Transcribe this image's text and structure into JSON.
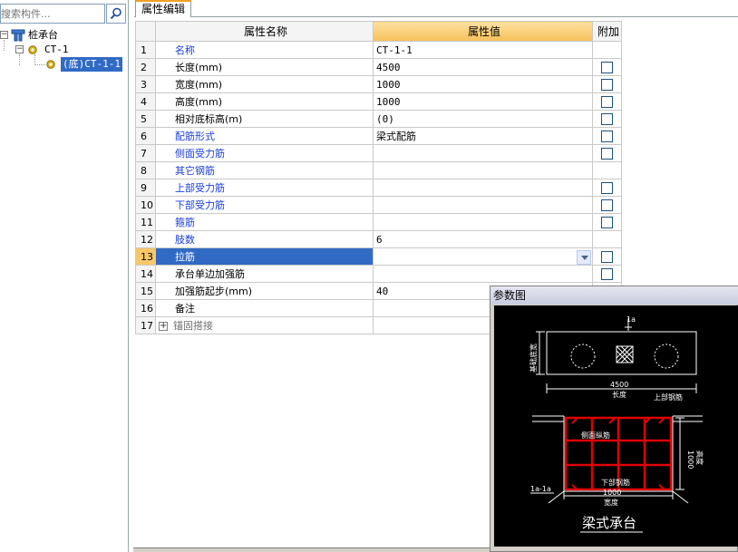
{
  "search": {
    "placeholder": "搜索构件..."
  },
  "tree": {
    "root_label": "桩承台",
    "child_label": "CT-1",
    "grandchild_label": "(底)CT-1-1"
  },
  "tabs": {
    "attr_edit": "属性编辑"
  },
  "grid": {
    "headers": {
      "name": "属性名称",
      "value": "属性值",
      "extra": "附加"
    },
    "rows": [
      {
        "num": "1",
        "name": "名称",
        "value": "CT-1-1",
        "checkbox": false,
        "style": "blue"
      },
      {
        "num": "2",
        "name": "长度(mm)",
        "value": "4500",
        "checkbox": true,
        "style": "black"
      },
      {
        "num": "3",
        "name": "宽度(mm)",
        "value": "1000",
        "checkbox": true,
        "style": "black"
      },
      {
        "num": "4",
        "name": "高度(mm)",
        "value": "1000",
        "checkbox": true,
        "style": "black"
      },
      {
        "num": "5",
        "name": "相对底标高(m)",
        "value": "(0)",
        "checkbox": true,
        "style": "black"
      },
      {
        "num": "6",
        "name": "配筋形式",
        "value": "梁式配筋",
        "checkbox": true,
        "style": "blue"
      },
      {
        "num": "7",
        "name": "侧面受力筋",
        "value": "",
        "checkbox": true,
        "style": "blue"
      },
      {
        "num": "8",
        "name": "其它钢筋",
        "value": "",
        "checkbox": false,
        "style": "blue"
      },
      {
        "num": "9",
        "name": "上部受力筋",
        "value": "",
        "checkbox": true,
        "style": "blue"
      },
      {
        "num": "10",
        "name": "下部受力筋",
        "value": "",
        "checkbox": true,
        "style": "blue"
      },
      {
        "num": "11",
        "name": "箍筋",
        "value": "",
        "checkbox": true,
        "style": "blue"
      },
      {
        "num": "12",
        "name": "肢数",
        "value": "6",
        "checkbox": false,
        "style": "blue"
      },
      {
        "num": "13",
        "name": "拉筋",
        "value": "",
        "checkbox": true,
        "style": "selected"
      },
      {
        "num": "14",
        "name": "承台单边加强筋",
        "value": "",
        "checkbox": true,
        "style": "black"
      },
      {
        "num": "15",
        "name": "加强筋起步(mm)",
        "value": "40",
        "checkbox": true,
        "style": "black"
      },
      {
        "num": "16",
        "name": "备注",
        "value": "",
        "checkbox": false,
        "style": "black"
      },
      {
        "num": "17",
        "name": "锚固搭接",
        "value": "",
        "checkbox": false,
        "style": "grey"
      }
    ]
  },
  "param_window": {
    "title": "参数图",
    "diagram": {
      "top_mark": "1a",
      "left_vertical": "基础底宽",
      "length_value": "4500",
      "length_label": "长度",
      "top_rebar": "上部钢筋",
      "side_rebar": "侧面纵筋",
      "bottom_rebar": "下部钢筋",
      "height_value": "1000",
      "height_label": "高度",
      "section_mark": "1a-1a",
      "width_value": "1000",
      "width_label": "宽度",
      "caption": "梁式承台"
    }
  }
}
